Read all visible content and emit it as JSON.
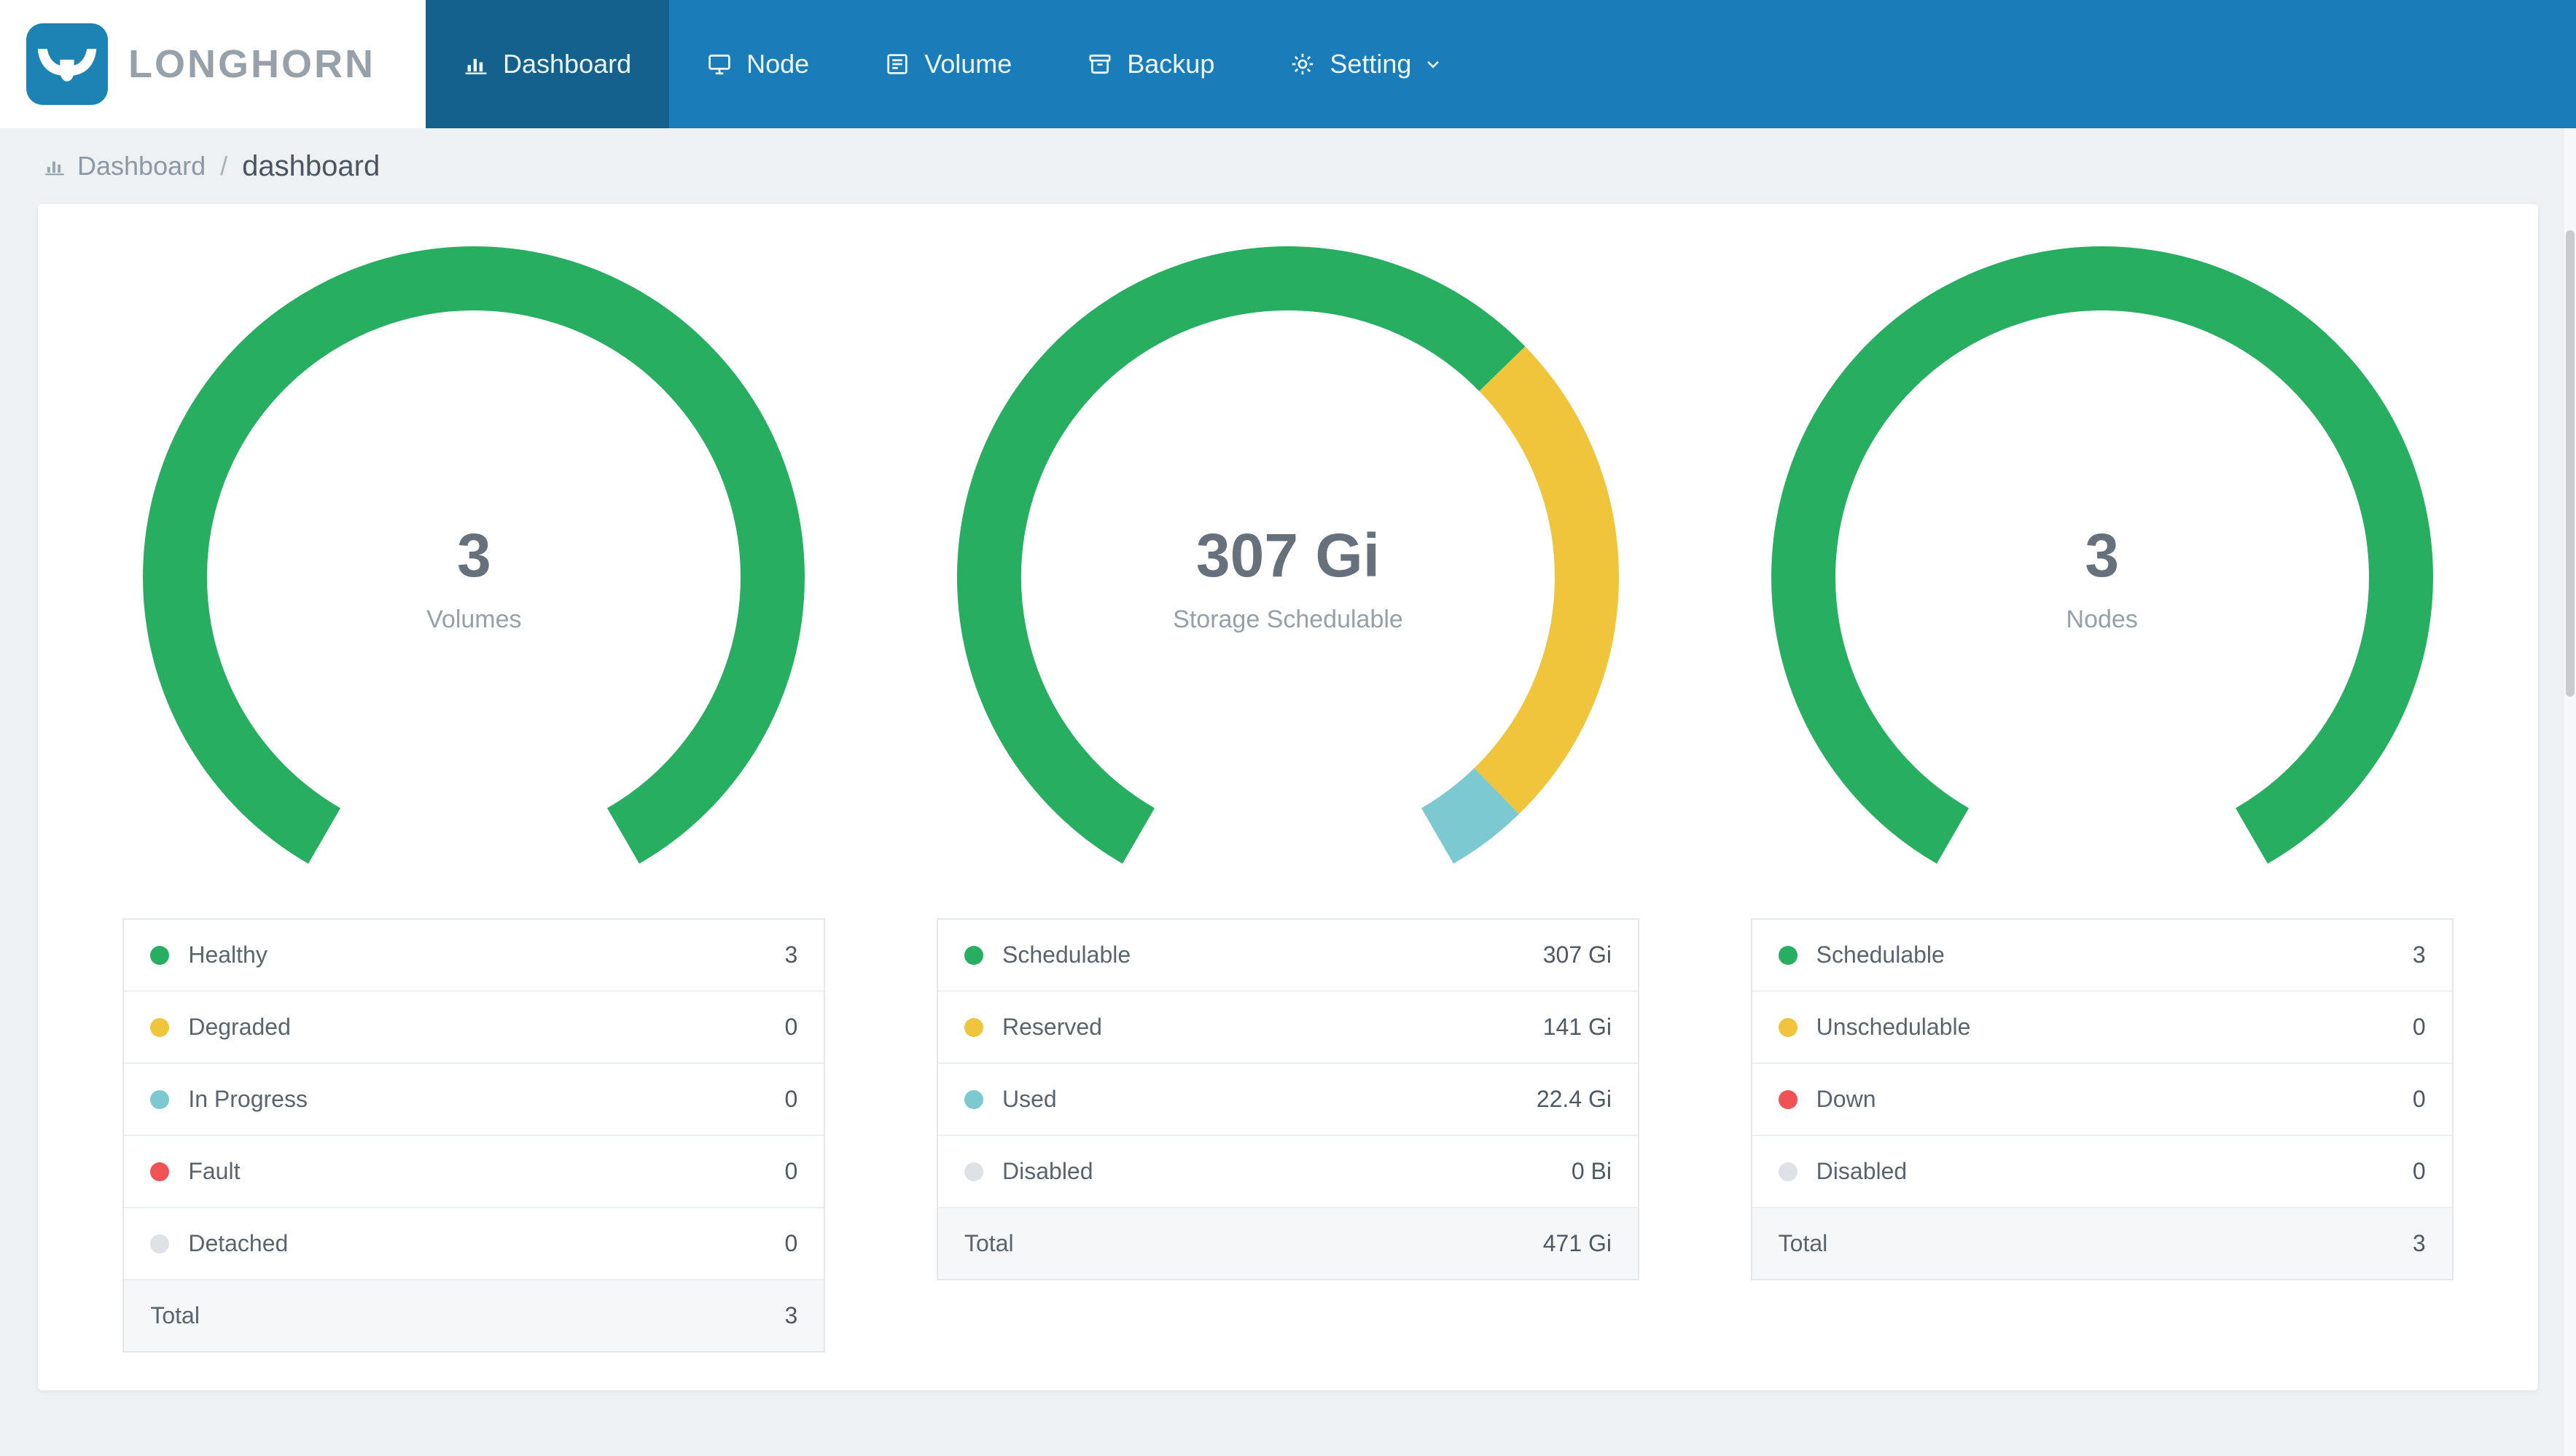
{
  "app": {
    "logo_text": "LONGHORN"
  },
  "colors": {
    "green": "#27AE60",
    "yellow": "#F0C53C",
    "teal": "#7CC9D2",
    "red": "#F05355",
    "gray": "#DEE2E6",
    "navbar": "#1A7CB8",
    "navbar_active": "#14618E",
    "logo_tile": "#1D83B4",
    "page_bg": "#EEF1F4"
  },
  "nav": {
    "items": [
      {
        "label": "Dashboard",
        "icon": "dashboard",
        "active": true
      },
      {
        "label": "Node",
        "icon": "node",
        "active": false
      },
      {
        "label": "Volume",
        "icon": "volume",
        "active": false
      },
      {
        "label": "Backup",
        "icon": "backup",
        "active": false
      },
      {
        "label": "Setting",
        "icon": "setting",
        "active": false,
        "dropdown": true
      }
    ]
  },
  "breadcrumb": {
    "section": "Dashboard",
    "separator": "/",
    "page": "dashboard"
  },
  "chart_data": [
    {
      "type": "pie",
      "variant": "gauge-donut",
      "name": "volumes",
      "title": "Volumes",
      "center_value": "3",
      "center_label": "Volumes",
      "arc": {
        "start_deg": 210,
        "span_deg": 300
      },
      "segments": [
        {
          "label": "Healthy",
          "num": 3,
          "display": "3",
          "color": "green"
        },
        {
          "label": "Degraded",
          "num": 0,
          "display": "0",
          "color": "yellow"
        },
        {
          "label": "In Progress",
          "num": 0,
          "display": "0",
          "color": "teal"
        },
        {
          "label": "Fault",
          "num": 0,
          "display": "0",
          "color": "red"
        },
        {
          "label": "Detached",
          "num": 0,
          "display": "0",
          "color": "gray"
        }
      ],
      "total": {
        "label": "Total",
        "display": "3"
      }
    },
    {
      "type": "pie",
      "variant": "gauge-donut",
      "name": "storage",
      "title": "Storage Schedulable",
      "center_value": "307 Gi",
      "center_label": "Storage Schedulable",
      "arc": {
        "start_deg": 210,
        "span_deg": 300
      },
      "segments": [
        {
          "label": "Schedulable",
          "num": 307,
          "display": "307 Gi",
          "color": "green"
        },
        {
          "label": "Reserved",
          "num": 141,
          "display": "141 Gi",
          "color": "yellow"
        },
        {
          "label": "Used",
          "num": 22.4,
          "display": "22.4 Gi",
          "color": "teal"
        },
        {
          "label": "Disabled",
          "num": 0,
          "display": "0 Bi",
          "color": "gray"
        }
      ],
      "total": {
        "label": "Total",
        "display": "471 Gi"
      }
    },
    {
      "type": "pie",
      "variant": "gauge-donut",
      "name": "nodes",
      "title": "Nodes",
      "center_value": "3",
      "center_label": "Nodes",
      "arc": {
        "start_deg": 210,
        "span_deg": 300
      },
      "segments": [
        {
          "label": "Schedulable",
          "num": 3,
          "display": "3",
          "color": "green"
        },
        {
          "label": "Unschedulable",
          "num": 0,
          "display": "0",
          "color": "yellow"
        },
        {
          "label": "Down",
          "num": 0,
          "display": "0",
          "color": "red"
        },
        {
          "label": "Disabled",
          "num": 0,
          "display": "0",
          "color": "gray"
        }
      ],
      "total": {
        "label": "Total",
        "display": "3"
      }
    }
  ]
}
